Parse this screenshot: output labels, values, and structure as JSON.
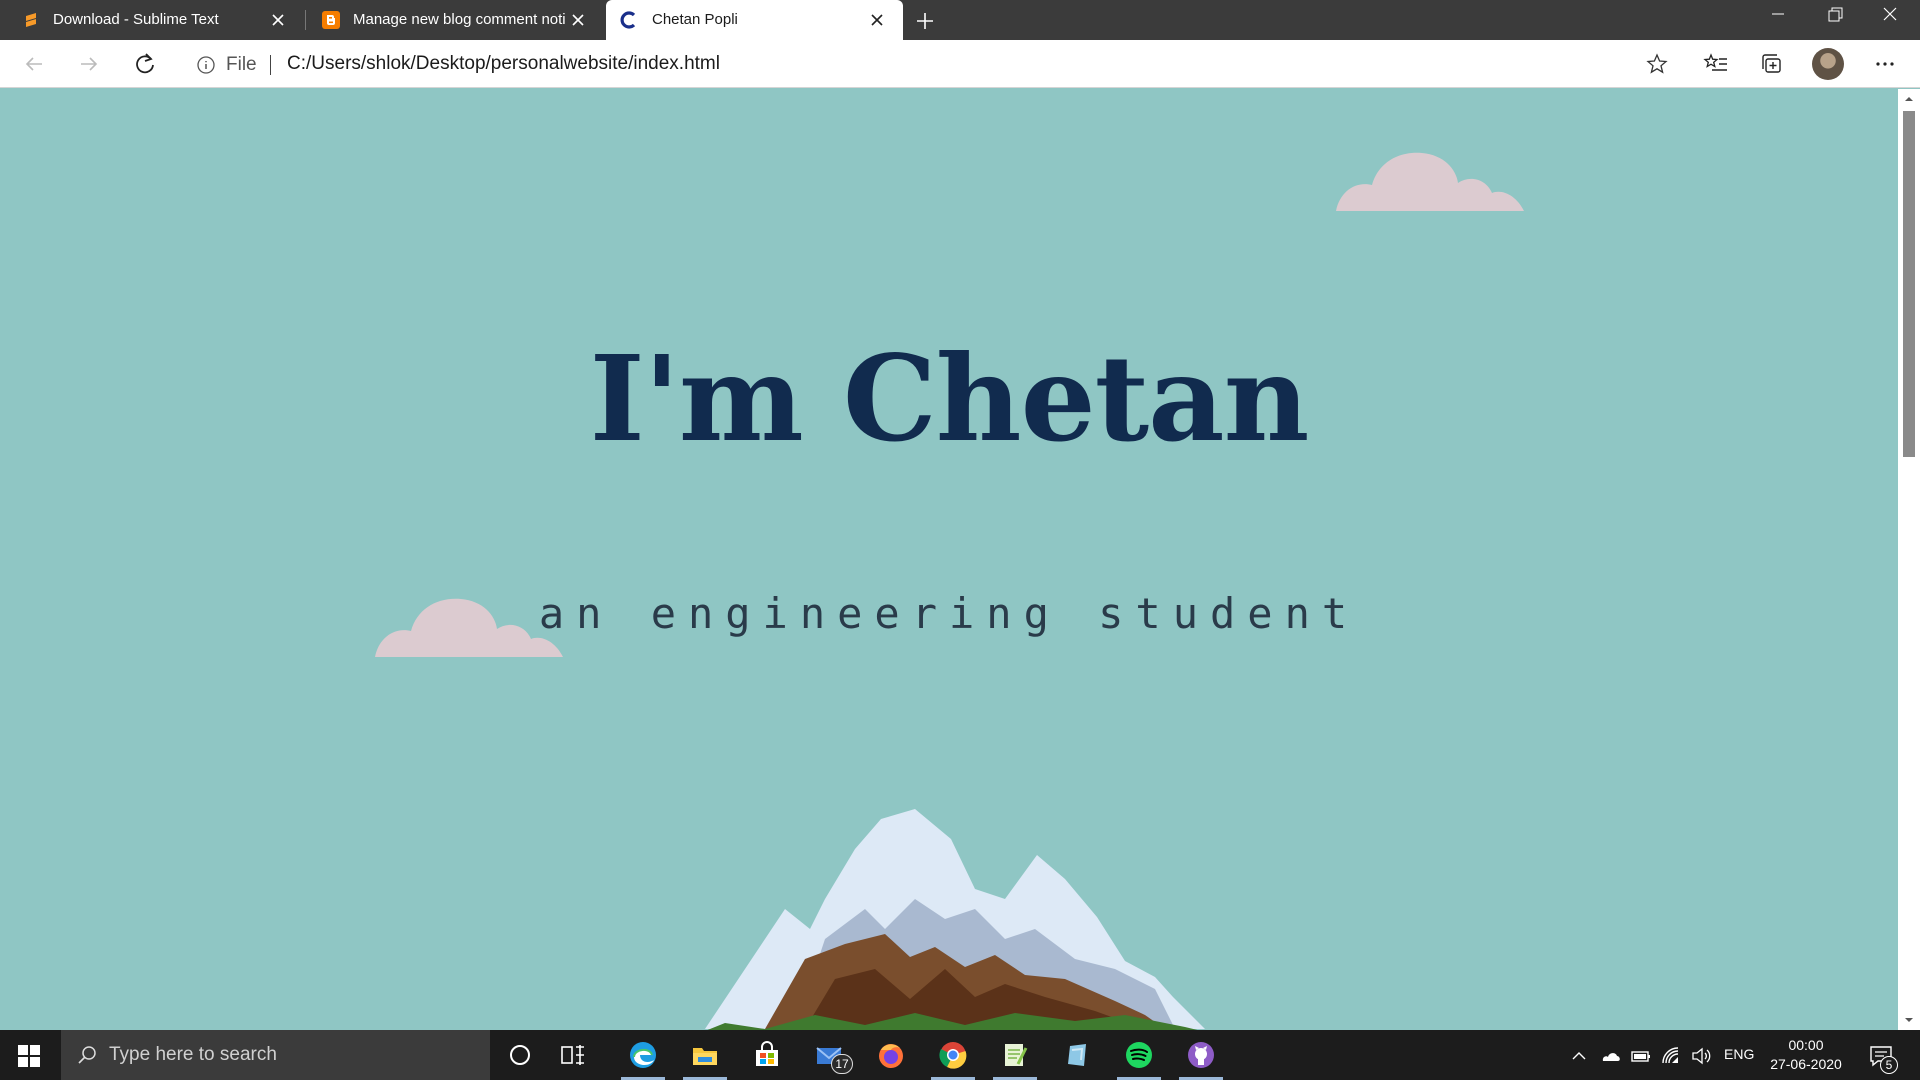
{
  "browser": {
    "tabs": [
      {
        "label": "Download - Sublime Text",
        "favicon": "sublime-text-icon"
      },
      {
        "label": "Manage new blog comment noti",
        "favicon": "blogger-icon"
      },
      {
        "label": "Chetan Popli",
        "favicon": "site-c-icon",
        "active": true
      }
    ],
    "address": {
      "scheme": "File",
      "url": "C:/Users/shlok/Desktop/personalwebsite/index.html"
    }
  },
  "page": {
    "heading": "I'm Chetan",
    "subtitle": "an engineering student",
    "colors": {
      "background": "#8fc6c4",
      "heading": "#112b4e",
      "cloud": "#d9c9cf"
    }
  },
  "taskbar": {
    "search_placeholder": "Type here to search",
    "apps": [
      "edge-icon",
      "file-explorer-icon",
      "store-icon",
      "mail-icon",
      "firefox-icon",
      "chrome-icon",
      "notepadplusplus-icon",
      "paint-icon",
      "spotify-icon",
      "github-desktop-icon"
    ],
    "mail_badge": "17",
    "language": "ENG",
    "time": "00:00",
    "date": "27-06-2020",
    "notifications": "5"
  }
}
